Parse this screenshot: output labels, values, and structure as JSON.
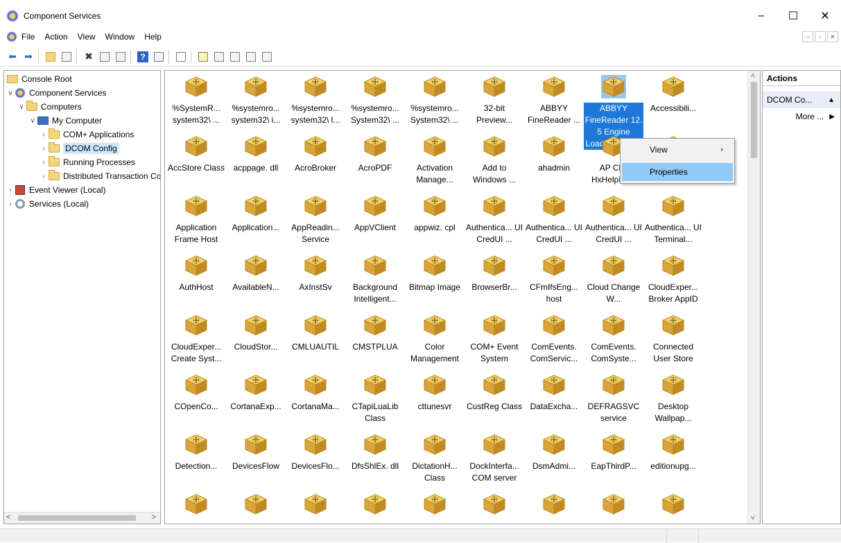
{
  "window": {
    "title": "Component Services",
    "minimize": "–",
    "maximize": "☐",
    "close": "✕"
  },
  "menu": {
    "items": [
      "File",
      "Action",
      "View",
      "Window",
      "Help"
    ],
    "mdi_minimize": "–",
    "mdi_restore": "จ",
    "mdi_close": "✕"
  },
  "tree": {
    "items": [
      {
        "label": "Console Root",
        "arrow": ""
      },
      {
        "label": "Component Services",
        "arrow": "∨"
      },
      {
        "label": "Computers",
        "arrow": "∨"
      },
      {
        "label": "My Computer",
        "arrow": "∨"
      },
      {
        "label": "COM+ Applications",
        "arrow": "›"
      },
      {
        "label": "DCOM Config",
        "arrow": "›"
      },
      {
        "label": "Running Processes",
        "arrow": "›"
      },
      {
        "label": "Distributed Transaction Coordinator",
        "arrow": "›"
      },
      {
        "label": "Event Viewer (Local)",
        "arrow": "›"
      },
      {
        "label": "Services (Local)",
        "arrow": "›"
      }
    ],
    "scroll_left": "<",
    "scroll_right": ">"
  },
  "grid": {
    "rows": [
      [
        "%SystemR... system32\\ ...",
        "%systemro... system32\\ i...",
        "%systemro... system32\\ l...",
        "%systemro... System32\\ ...",
        "%systemro... System32\\ ...",
        "32-bit Preview...",
        "ABBYY FineReader ...",
        "ABBYY FineReader 12. 5 Engine Loader Service",
        "Accessibili..."
      ],
      [
        "AccStore Class",
        "acppage. dll",
        "AcroBroker",
        "AcroPDF",
        "Activation Manage...",
        "Add to Windows ...",
        "ahadmin",
        "AP Cl... HxHelpPa...",
        "HxHelpPa..."
      ],
      [
        "Application Frame Host",
        "Application...",
        "AppReadin... Service",
        "AppVClient",
        "appwiz. cpl",
        "Authentica... UI CredUI ...",
        "Authentica... UI CredUI ...",
        "Authentica... UI CredUI ...",
        "Authentica... UI Terminal..."
      ],
      [
        "AuthHost",
        "AvailableN...",
        "AxInstSv",
        "Background Intelligent...",
        "Bitmap Image",
        "BrowserBr...",
        "CFmIfsEng... host",
        "Cloud Change W...",
        "CloudExper... Broker AppID"
      ],
      [
        "CloudExper... Create Syst...",
        "CloudStor...",
        "CMLUAUTIL",
        "CMSTPLUA",
        "Color Management",
        "COM+ Event System",
        "ComEvents. ComServic...",
        "ComEvents. ComSyste...",
        "Connected User Store"
      ],
      [
        "COpenCo...",
        "CortanaExp...",
        "CortanaMa...",
        "CTapiLuaLib Class",
        "cttunesvr",
        "CustReg Class",
        "DataExcha...",
        "DEFRAGSVC service",
        "Desktop Wallpap..."
      ],
      [
        "Detection...",
        "DevicesFlow",
        "DevicesFlo...",
        "DfsShlEx. dll",
        "DictationH... Class",
        "DockInterfa... COM server",
        "DsmAdmi...",
        "EapThirdP...",
        "editionupg..."
      ],
      [
        "",
        "",
        "",
        "",
        "",
        "",
        "",
        "",
        ""
      ]
    ],
    "scroll_up": "˄",
    "scroll_down": "˅"
  },
  "context_menu": {
    "view": "View",
    "view_arrow": "›",
    "properties": "Properties"
  },
  "actions": {
    "header": "Actions",
    "section": "DCOM Co...",
    "section_arrow": "▲",
    "more": "More ...",
    "more_arrow": "▶"
  }
}
